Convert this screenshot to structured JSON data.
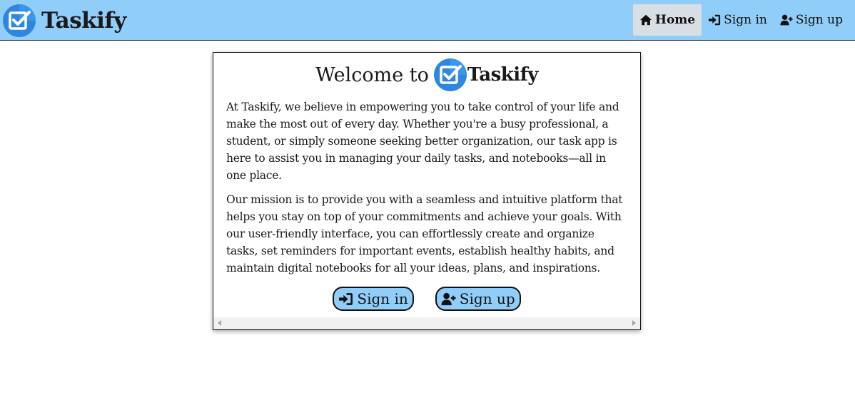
{
  "header": {
    "brand_name": "Taskify",
    "logo_icon": "taskify-logo-icon",
    "nav": [
      {
        "label": "Home",
        "icon": "home-icon",
        "active": true
      },
      {
        "label": "Sign in",
        "icon": "sign-in-icon",
        "active": false
      },
      {
        "label": "Sign up",
        "icon": "user-plus-icon",
        "active": false
      }
    ]
  },
  "welcome": {
    "title_prefix": "Welcome to",
    "brand_name": "Taskify",
    "paragraphs": [
      "At Taskify, we believe in empowering you to take control of your life and make the most out of every day. Whether you're a busy professional, a student, or simply someone seeking better organization, our task app is here to assist you in managing your daily tasks, and notebooks—all in one place.",
      "Our mission is to provide you with a seamless and intuitive platform that helps you stay on top of your commitments and achieve your goals. With our user-friendly interface, you can effortlessly create and organize tasks, set reminders for important events, establish healthy habits, and maintain digital notebooks for all your ideas, plans, and inspirations."
    ],
    "signin_button": "Sign in",
    "signup_button": "Sign up"
  },
  "colors": {
    "navbar_bg": "#90cdf8",
    "button_bg": "#90cdf8",
    "logo_blue": "#2f86e0",
    "active_nav_bg": "#d7dee4"
  }
}
